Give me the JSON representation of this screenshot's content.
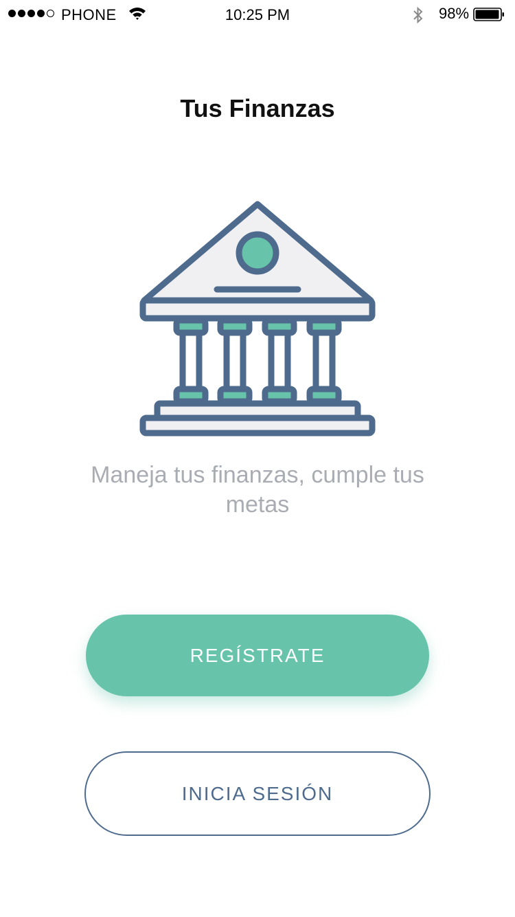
{
  "status_bar": {
    "carrier": "PHONE",
    "time": "10:25 PM",
    "battery_percent": "98%",
    "signal_bars_filled": 4,
    "signal_bars_total": 5,
    "icons": [
      "signal-icon",
      "wifi-icon",
      "bluetooth-icon",
      "battery-icon"
    ]
  },
  "header": {
    "title": "Tus Finanzas"
  },
  "hero": {
    "illustration_icon": "bank-icon",
    "tagline": "Maneja tus finanzas, cumple tus metas"
  },
  "actions": {
    "register_label": "REGÍSTRATE",
    "login_label": "INICIA SESIÓN"
  },
  "colors": {
    "accent": "#67c4ab",
    "navy": "#4e6b8e",
    "muted_text": "#a9adb3",
    "illustration_fill": "#f0f0f2"
  }
}
